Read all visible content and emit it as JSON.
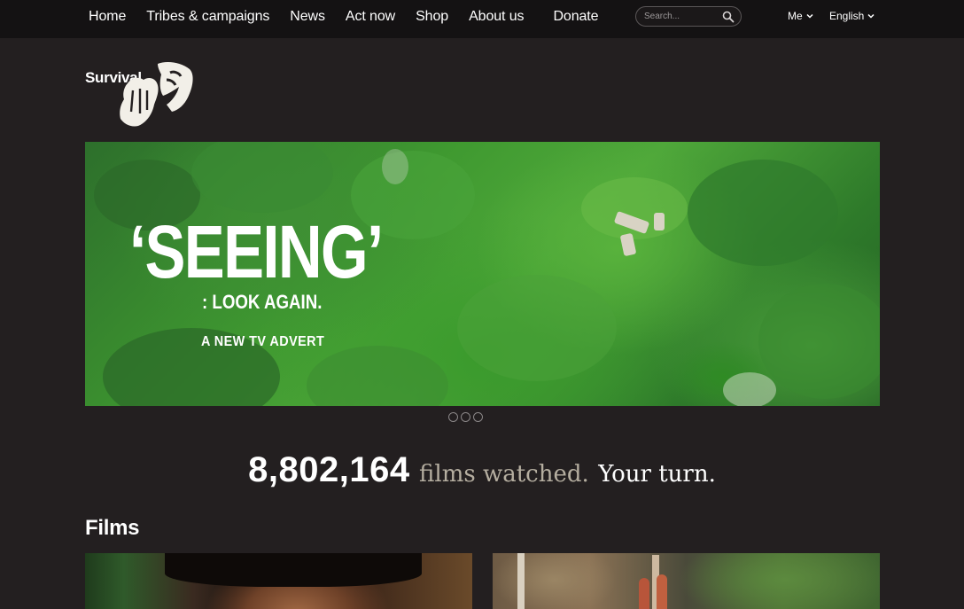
{
  "nav": {
    "items": [
      "Home",
      "Tribes & campaigns",
      "News",
      "Act now",
      "Shop",
      "About us"
    ],
    "donate": "Donate"
  },
  "search": {
    "placeholder": "Search..."
  },
  "user_menu": {
    "me": "Me",
    "language": "English"
  },
  "logo": {
    "text": "Survival"
  },
  "hero": {
    "title": "‘SEEING’",
    "subtitle": ": LOOK AGAIN.",
    "tagline": "A NEW TV ADVERT"
  },
  "carousel": {
    "slide_count": 3,
    "active_index": 0
  },
  "counter": {
    "number": "8,802,164",
    "label": "films watched.",
    "cta": "Your turn."
  },
  "films": {
    "heading": "Films"
  },
  "colors": {
    "background": "#231f20",
    "topbar": "#141213",
    "muted_text": "#b5aea0"
  }
}
